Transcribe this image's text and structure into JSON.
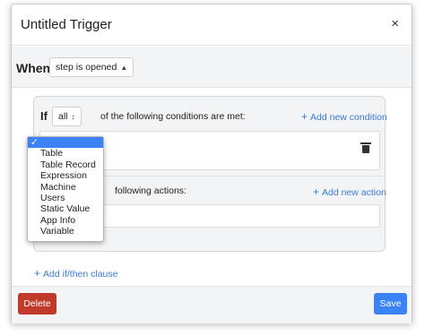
{
  "modal": {
    "title": "Untitled Trigger",
    "close_label": "×"
  },
  "when": {
    "label": "When",
    "event_value": "step is opened"
  },
  "clause": {
    "if_label": "If",
    "match_value": "all",
    "conditions_text": "of the following conditions are met:",
    "add_condition_label": "Add new condition",
    "then_text": "following actions:",
    "add_action_label": "Add new action"
  },
  "dropdown": {
    "selected_label": "✓",
    "options": [
      "Table",
      "Table Record",
      "Expression",
      "Machine",
      "Users",
      "Static Value",
      "App Info",
      "Variable"
    ]
  },
  "add_clause_label": "Add if/then clause",
  "footer": {
    "delete_label": "Delete",
    "save_label": "Save"
  },
  "colors": {
    "link": "#3a7bd5",
    "delete": "#c0392b",
    "save": "#3b82f6",
    "selected_option": "#3b82f6"
  }
}
